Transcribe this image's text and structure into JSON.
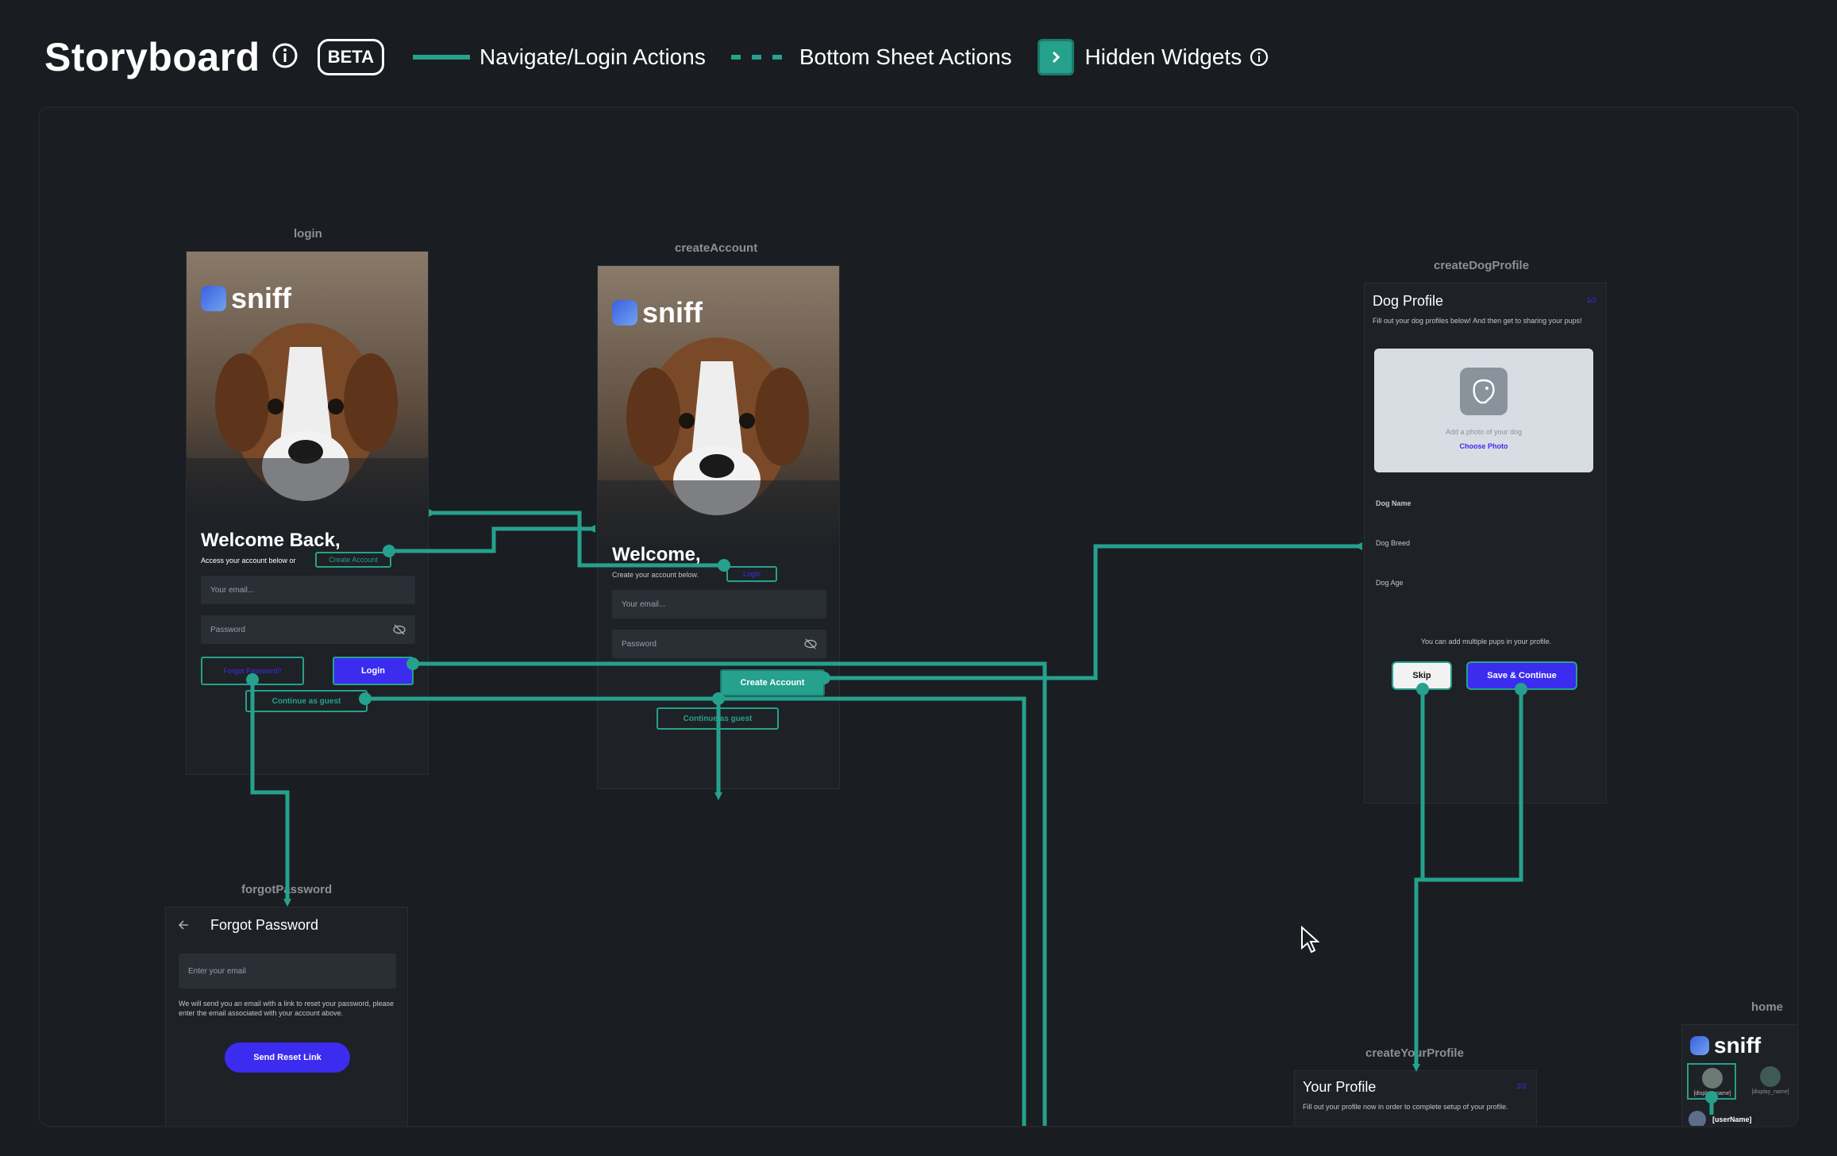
{
  "header": {
    "title": "Storyboard",
    "beta": "BETA",
    "legend_solid": "Navigate/Login Actions",
    "legend_dashed": "Bottom Sheet Actions",
    "legend_hidden": "Hidden Widgets"
  },
  "colors": {
    "accent": "#25a18d",
    "primary": "#3b2cf0",
    "background": "#191c20"
  },
  "login": {
    "label": "login",
    "logo": "sniff",
    "welcome": "Welcome Back,",
    "subtitle": "Access your account below or",
    "create_account": "Create Account",
    "email": "Your email...",
    "password": "Password",
    "forgot": "Forgot Password?",
    "login_btn": "Login",
    "guest": "Continue as guest"
  },
  "createAccount": {
    "label": "createAccount",
    "logo": "sniff",
    "welcome": "Welcome,",
    "subtitle": "Create your account below.",
    "login_link": "Login",
    "email": "Your email...",
    "password": "Password",
    "create_btn": "Create Account",
    "guest": "Continue as guest"
  },
  "forgotPassword": {
    "label": "forgotPassword",
    "title": "Forgot Password",
    "email": "Enter your email",
    "desc": "We will send you an email with a link to reset your password, please enter the email associated with your account above.",
    "send_btn": "Send Reset Link"
  },
  "createDogProfile": {
    "label": "createDogProfile",
    "title": "Dog Profile",
    "step": "1/2",
    "desc": "Fill out your dog profiles below! And then get to sharing your pups!",
    "photo_hint": "Add a photo of your dog",
    "choose_photo": "Choose Photo",
    "dog_name": "Dog Name",
    "dog_breed": "Dog Breed",
    "dog_age": "Dog Age",
    "multi_hint": "You can add multiple pups in your profile.",
    "skip": "Skip",
    "save": "Save & Continue"
  },
  "createYourProfile": {
    "label": "createYourProfile",
    "title": "Your Profile",
    "step": "2/2",
    "desc": "Fill out your profile now in order to complete setup of your profile."
  },
  "home": {
    "label": "home",
    "logo": "sniff",
    "display_name_1": "[display_name]",
    "display_name_2": "[display_name]",
    "user_name": "[userName]"
  }
}
